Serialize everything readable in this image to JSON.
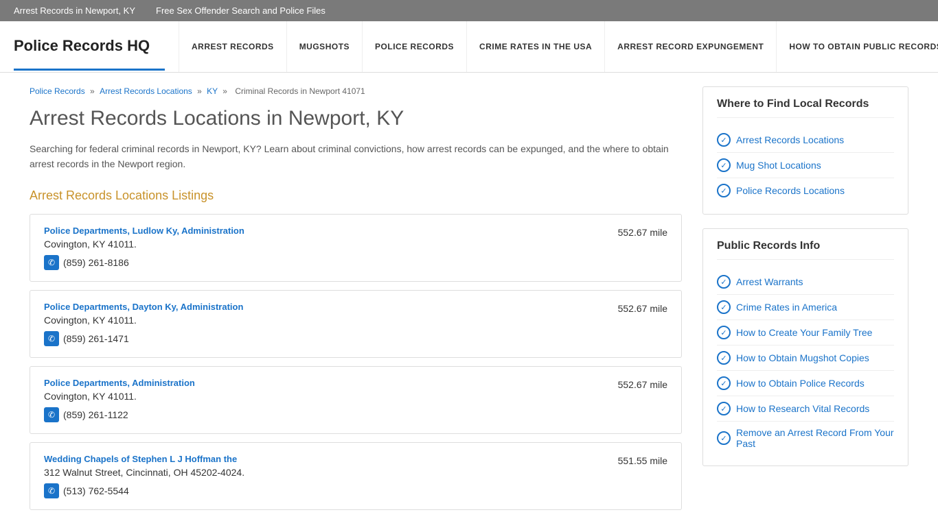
{
  "topbar": {
    "links": [
      {
        "label": "Arrest Records in Newport, KY"
      },
      {
        "label": "Free Sex Offender Search and Police Files"
      }
    ]
  },
  "header": {
    "logo": "Police Records HQ",
    "nav": [
      {
        "label": "ARREST RECORDS"
      },
      {
        "label": "MUGSHOTS"
      },
      {
        "label": "POLICE RECORDS"
      },
      {
        "label": "CRIME RATES IN THE USA"
      },
      {
        "label": "ARREST RECORD EXPUNGEMENT"
      },
      {
        "label": "HOW TO OBTAIN PUBLIC RECORDS"
      }
    ]
  },
  "breadcrumb": {
    "items": [
      {
        "label": "Police Records",
        "href": "#"
      },
      {
        "label": "Arrest Records Locations",
        "href": "#"
      },
      {
        "label": "KY",
        "href": "#"
      },
      {
        "label": "Criminal Records in Newport 41071"
      }
    ]
  },
  "page": {
    "title": "Arrest Records Locations in Newport, KY",
    "description": "Searching for federal criminal records in Newport, KY? Learn about criminal convictions, how arrest records can be expunged, and the where to obtain arrest records in the Newport region.",
    "section_heading": "Arrest Records Locations Listings"
  },
  "listings": [
    {
      "name": "Police Departments, Ludlow Ky, Administration",
      "address": "Covington, KY 41011.",
      "phone": "(859) 261-8186",
      "distance": "552.67 mile"
    },
    {
      "name": "Police Departments, Dayton Ky, Administration",
      "address": "Covington, KY 41011.",
      "phone": "(859) 261-1471",
      "distance": "552.67 mile"
    },
    {
      "name": "Police Departments, Administration",
      "address": "Covington, KY 41011.",
      "phone": "(859) 261-1122",
      "distance": "552.67 mile"
    },
    {
      "name": "Wedding Chapels of Stephen L J Hoffman the",
      "address": "312 Walnut Street, Cincinnati, OH 45202-4024.",
      "phone": "(513) 762-5544",
      "distance": "551.55 mile"
    }
  ],
  "sidebar": {
    "section1": {
      "title": "Where to Find Local Records",
      "links": [
        {
          "label": "Arrest Records Locations"
        },
        {
          "label": "Mug Shot Locations"
        },
        {
          "label": "Police Records Locations"
        }
      ]
    },
    "section2": {
      "title": "Public Records Info",
      "links": [
        {
          "label": "Arrest Warrants"
        },
        {
          "label": "Crime Rates in America"
        },
        {
          "label": "How to Create Your Family Tree"
        },
        {
          "label": "How to Obtain Mugshot Copies"
        },
        {
          "label": "How to Obtain Police Records"
        },
        {
          "label": "How to Research Vital Records"
        },
        {
          "label": "Remove an Arrest Record From Your Past"
        }
      ]
    }
  }
}
